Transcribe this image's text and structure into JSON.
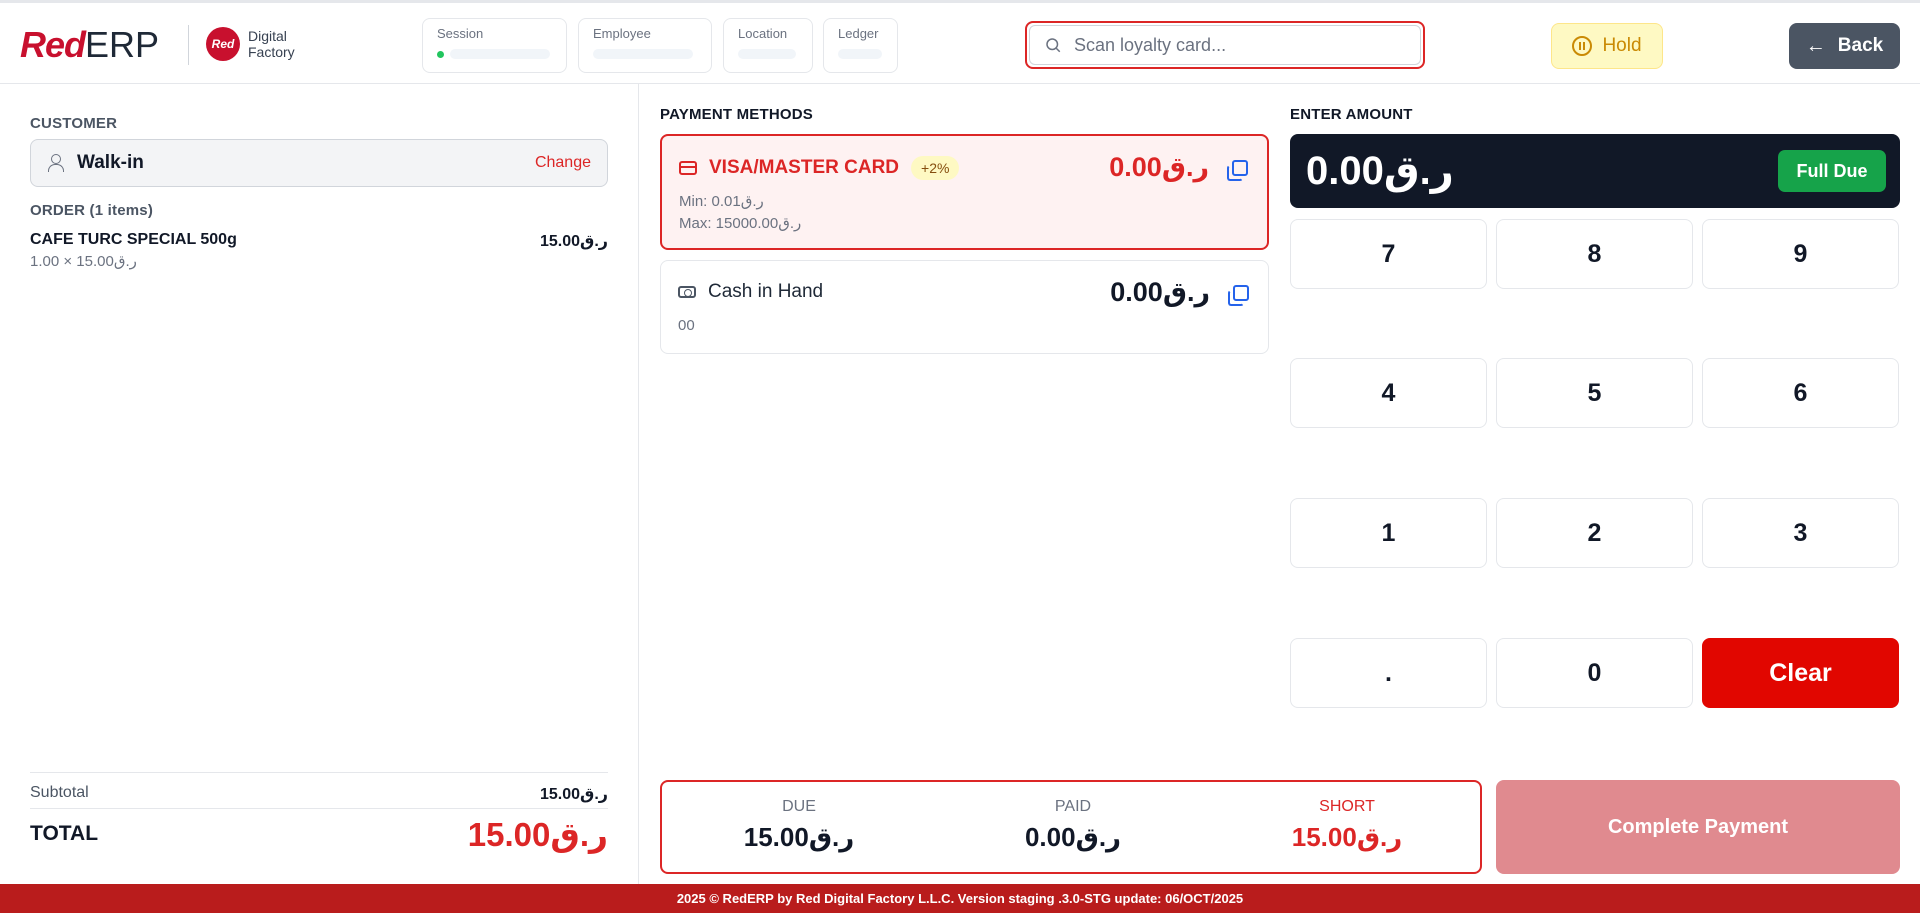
{
  "brand": {
    "logo_red": "Red",
    "logo_erp": "ERP",
    "partner_circle": "Red",
    "partner_line1": "Digital",
    "partner_line2": "Factory"
  },
  "header_info": [
    {
      "label": "Session"
    },
    {
      "label": "Employee"
    },
    {
      "label": "Location"
    },
    {
      "label": "Ledger"
    }
  ],
  "search": {
    "placeholder": "Scan loyalty card..."
  },
  "toolbar": {
    "hold_label": "Hold",
    "back_label": "Back"
  },
  "customer": {
    "section_label": "CUSTOMER",
    "name": "Walk-in",
    "change_label": "Change"
  },
  "order": {
    "section_label": "ORDER (1 items)",
    "items": [
      {
        "name": "CAFE TURC SPECIAL 500g",
        "price": "15.00ر.ق",
        "qty_line": "1.00 × 15.00ر.ق"
      }
    ]
  },
  "totals": {
    "subtotal_label": "Subtotal",
    "subtotal_value": "15.00ر.ق",
    "total_label": "TOTAL",
    "total_value": "15.00ر.ق"
  },
  "payment_methods": {
    "section_label": "PAYMENT METHODS",
    "methods": [
      {
        "name": "VISA/MASTER CARD",
        "badge": "+2%",
        "amount": "0.00ر.ق",
        "min": "Min: 0.01ر.ق",
        "max": "Max: 15000.00ر.ق",
        "active": true
      },
      {
        "name": "Cash in Hand",
        "amount": "0.00ر.ق",
        "sub": "00",
        "active": false
      }
    ]
  },
  "amount_entry": {
    "section_label": "ENTER AMOUNT",
    "value": "0.00ر.ق",
    "full_due_label": "Full Due",
    "keys": [
      "7",
      "8",
      "9",
      "4",
      "5",
      "6",
      "1",
      "2",
      "3",
      ".",
      "0",
      "Clear"
    ]
  },
  "summary": {
    "due_label": "DUE",
    "due_value": "15.00ر.ق",
    "paid_label": "PAID",
    "paid_value": "0.00ر.ق",
    "short_label": "SHORT",
    "short_value": "15.00ر.ق"
  },
  "complete_label": "Complete Payment",
  "footer": "2025 © RedERP by Red Digital Factory L.L.C. Version staging .3.0-STG update: 06/OCT/2025",
  "colors": {
    "brand_red": "#dc2626",
    "dark": "#111827",
    "success": "#16a34a",
    "hold_bg": "#fef9c3",
    "footer_bg": "#b91c1c"
  }
}
